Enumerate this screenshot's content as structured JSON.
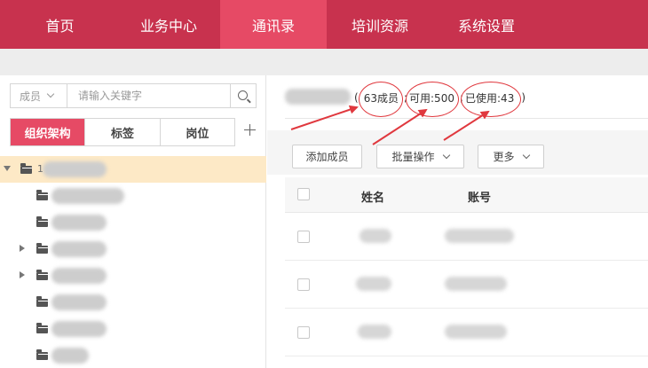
{
  "nav": {
    "items": [
      {
        "label": "首页",
        "active": false
      },
      {
        "label": "业务中心",
        "active": false
      },
      {
        "label": "通讯录",
        "active": true
      },
      {
        "label": "培训资源",
        "active": false
      },
      {
        "label": "系统设置",
        "active": false
      }
    ]
  },
  "sidebar": {
    "search": {
      "type_label": "成员",
      "placeholder": "请输入关键字"
    },
    "tabs": [
      {
        "label": "组织架构",
        "active": true
      },
      {
        "label": "标签",
        "active": false
      },
      {
        "label": "岗位",
        "active": false
      }
    ],
    "add_icon": "plus-icon",
    "root_prefix": "1"
  },
  "main": {
    "stats": {
      "members": "63成员",
      "available": "可用:500",
      "used": "已使用:43",
      "open": "(",
      "close": ")",
      "sep": ";"
    },
    "toolbar": {
      "add_member": "添加成员",
      "batch": "批量操作",
      "more": "更多"
    },
    "table": {
      "columns": [
        "姓名",
        "账号"
      ]
    }
  },
  "colors": {
    "nav_bg": "#c8324e",
    "nav_active": "#e64a65",
    "accent": "#e64a65",
    "annotation": "#e0383e"
  }
}
